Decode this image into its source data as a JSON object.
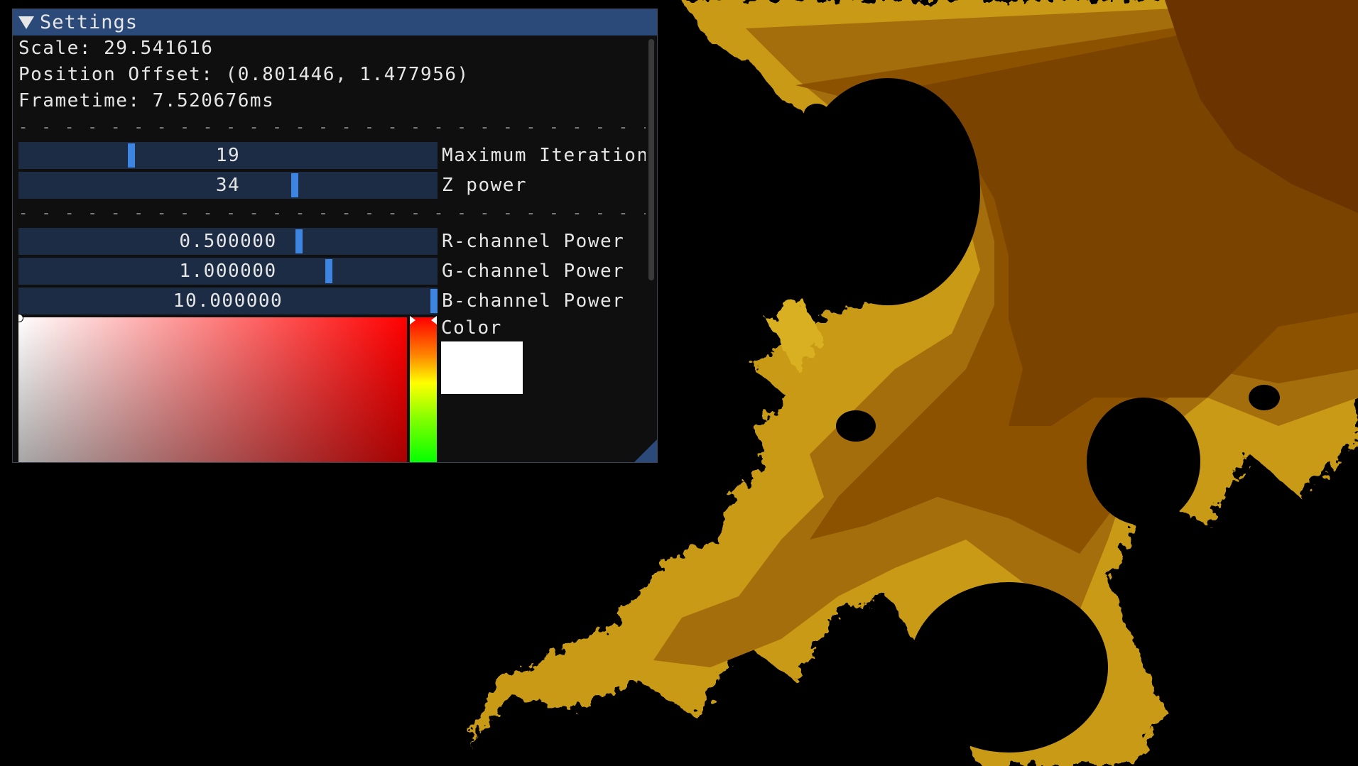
{
  "window": {
    "title": "Settings"
  },
  "stats": {
    "scale": "Scale: 29.541616",
    "offset": "Position Offset: (0.801446, 1.477956)",
    "frametime": "Frametime: 7.520676ms"
  },
  "separator": "- - - - - - - - - - - - - - - - - - - - - - - - - - - - - - - - - - - - - - - - - - - - -",
  "sliders": [
    {
      "value": "19",
      "label": "Maximum Iteration",
      "fraction": 0.27
    },
    {
      "value": "34",
      "label": "Z power",
      "fraction": 0.66
    }
  ],
  "channel_sliders": [
    {
      "value": "0.500000",
      "label": "R-channel Power",
      "fraction": 0.67
    },
    {
      "value": "1.000000",
      "label": "G-channel Power",
      "fraction": 0.74
    },
    {
      "value": "10.000000",
      "label": "B-channel Power",
      "fraction": 1.0
    }
  ],
  "color": {
    "label": "Color",
    "value": "#ffffff",
    "hue": "#ff0000"
  },
  "colors": {
    "title_bar": "#2b4a7a",
    "slider_bg": "#1c2c45",
    "grab": "#3d85e0"
  }
}
